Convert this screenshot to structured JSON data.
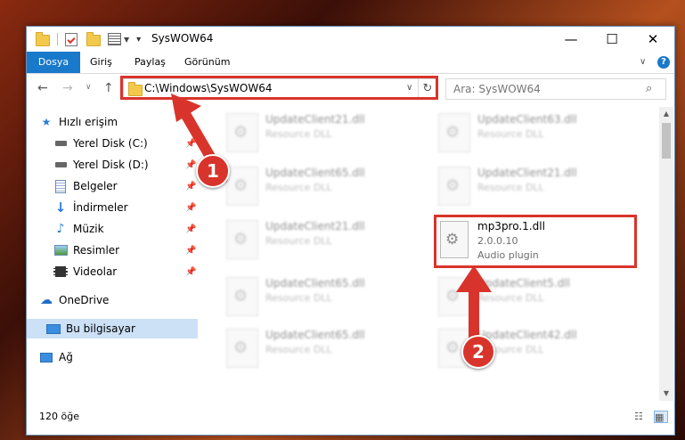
{
  "window": {
    "title": "SysWOW64",
    "controls": {
      "minimize": "—",
      "maximize": "☐",
      "close": "✕"
    }
  },
  "ribbon": {
    "tabs": [
      {
        "label": "Dosya"
      },
      {
        "label": "Giriş"
      },
      {
        "label": "Paylaş"
      },
      {
        "label": "Görünüm"
      }
    ],
    "help": "?"
  },
  "nav": {
    "address": "C:\\Windows\\SysWOW64",
    "search_placeholder": "Ara: SysWOW64"
  },
  "sidebar": {
    "items": [
      {
        "label": "Hızlı erişim",
        "icon": "star-icon"
      },
      {
        "label": "Yerel Disk (C:)",
        "icon": "drive-icon",
        "pinned": true
      },
      {
        "label": "Yerel Disk (D:)",
        "icon": "drive-icon",
        "pinned": true
      },
      {
        "label": "Belgeler",
        "icon": "documents-icon",
        "pinned": true
      },
      {
        "label": "İndirmeler",
        "icon": "download-icon",
        "pinned": true
      },
      {
        "label": "Müzik",
        "icon": "music-icon",
        "pinned": true
      },
      {
        "label": "Resimler",
        "icon": "pictures-icon",
        "pinned": true
      },
      {
        "label": "Videolar",
        "icon": "video-icon",
        "pinned": true
      },
      {
        "label": "OneDrive",
        "icon": "cloud-icon"
      },
      {
        "label": "Bu bilgisayar",
        "icon": "computer-icon",
        "selected": true
      },
      {
        "label": "Ağ",
        "icon": "network-icon"
      }
    ]
  },
  "files": [
    {
      "name": "UpdateClient21.dll",
      "desc": "Resource DLL"
    },
    {
      "name": "UpdateClient63.dll",
      "desc": "Resource DLL"
    },
    {
      "name": "UpdateClient65.dll",
      "desc": "Resource DLL"
    },
    {
      "name": "UpdateClient21.dll",
      "desc": "Resource DLL"
    },
    {
      "name": "UpdateClient21.dll",
      "desc": "Resource DLL"
    },
    {
      "name": "UpdateClient65.dll",
      "desc": "Resource DLL"
    },
    {
      "name": "UpdateClient5.dll",
      "desc": "Resource DLL"
    },
    {
      "name": "UpdateClient65.dll",
      "desc": "Resource DLL"
    },
    {
      "name": "UpdateClient42.dll",
      "desc": "Resource DLL"
    }
  ],
  "highlighted_file": {
    "name": "mp3pro.1.dll",
    "version": "2.0.0.10",
    "description": "Audio plugin"
  },
  "status": {
    "count": "120 öğe"
  },
  "annotations": {
    "step1": "1",
    "step2": "2",
    "color": "#d9342b"
  }
}
